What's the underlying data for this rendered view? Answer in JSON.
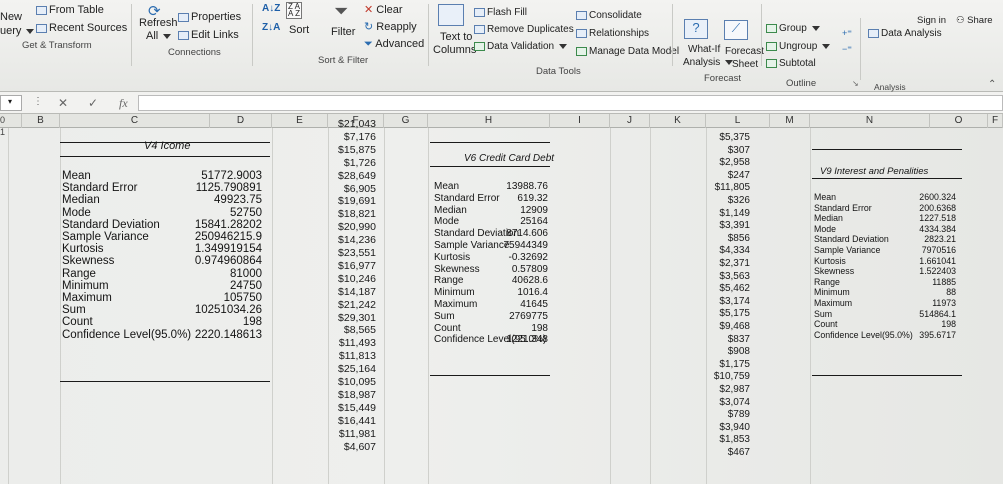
{
  "ribbon": {
    "get_transform": {
      "new_query": "New",
      "new_query_sub": "uery",
      "from_table": "From Table",
      "recent_sources": "Recent Sources",
      "group_label": "Get & Transform"
    },
    "connections": {
      "refresh_all": "Refresh",
      "refresh_all_sub": "All",
      "properties": "Properties",
      "edit_links": "Edit Links",
      "group_label": "Connections"
    },
    "sort_filter": {
      "sort": "Sort",
      "filter": "Filter",
      "clear": "Clear",
      "reapply": "Reapply",
      "advanced": "Advanced",
      "group_label": "Sort & Filter"
    },
    "data_tools": {
      "text_to_columns_1": "Text to",
      "text_to_columns_2": "Columns",
      "flash_fill": "Flash Fill",
      "remove_duplicates": "Remove Duplicates",
      "data_validation": "Data Validation",
      "consolidate": "Consolidate",
      "relationships": "Relationships",
      "manage_data_model": "Manage Data Model",
      "group_label": "Data Tools"
    },
    "forecast": {
      "what_if_1": "What-If",
      "what_if_2": "Analysis",
      "forecast_sheet_1": "Forecast",
      "forecast_sheet_2": "Sheet",
      "group_label": "Forecast"
    },
    "outline": {
      "group": "Group",
      "ungroup": "Ungroup",
      "subtotal": "Subtotal",
      "group_label": "Outline"
    },
    "analysis": {
      "data_analysis": "Data Analysis",
      "group_label": "Analysis"
    },
    "sign_in": "Sign in",
    "share": "Share"
  },
  "formula_bar": {
    "cancel": "✕",
    "enter": "✓",
    "fx": "fx"
  },
  "columns": [
    "B",
    "C",
    "D",
    "E",
    "F",
    "G",
    "H",
    "I",
    "J",
    "K",
    "L",
    "M",
    "N",
    "O",
    "F"
  ],
  "rows": [
    "0",
    "1",
    "",
    "",
    "",
    "",
    "",
    "",
    "",
    "",
    "",
    "",
    "",
    "",
    ""
  ],
  "v4": {
    "title": "V4 Icome",
    "labels": [
      "Mean",
      "Standard Error",
      "Median",
      "Mode",
      "Standard Deviation",
      "Sample Variance",
      "Kurtosis",
      "Skewness",
      "Range",
      "Minimum",
      "Maximum",
      "Sum",
      "Count",
      "Confidence Level(95.0%)"
    ],
    "values": [
      "51772.9003",
      "1125.790891",
      "49923.75",
      "52750",
      "15841.28202",
      "250946215.9",
      "1.349919154",
      "0.974960864",
      "81000",
      "24750",
      "105750",
      "10251034.26",
      "198",
      "2220.148613"
    ]
  },
  "col_f": [
    "$21,043",
    "$7,176",
    "$15,875",
    "$1,726",
    "$28,649",
    "$6,905",
    "$19,691",
    "$18,821",
    "$20,990",
    "$14,236",
    "$23,551",
    "$16,977",
    "$10,246",
    "$14,187",
    "$21,242",
    "$29,301",
    "$8,565",
    "$11,493",
    "$11,813",
    "$25,164",
    "$10,095",
    "$18,987",
    "$15,449",
    "$16,441",
    "$11,981",
    "$4,607"
  ],
  "v6": {
    "title": "V6 Credit Card Debt",
    "labels": [
      "Mean",
      "Standard Error",
      "Median",
      "Mode",
      "Standard Deviation",
      "Sample Variance",
      "Kurtosis",
      "Skewness",
      "Range",
      "Minimum",
      "Maximum",
      "Sum",
      "Count",
      "Confidence Level(95.0%)"
    ],
    "values": [
      "13988.76",
      "619.32",
      "12909",
      "25164",
      "8714.606",
      "75944349",
      "-0.32692",
      "0.57809",
      "40628.6",
      "1016.4",
      "41645",
      "2769775",
      "198",
      "1221.348"
    ]
  },
  "col_l": [
    "$5,375",
    "$307",
    "$2,958",
    "$247",
    "$11,805",
    "$326",
    "$1,149",
    "$3,391",
    "$856",
    "$4,334",
    "$2,371",
    "$3,563",
    "$5,462",
    "$3,174",
    "$5,175",
    "$9,468",
    "$837",
    "$908",
    "$1,175",
    "$10,759",
    "$2,987",
    "$3,074",
    "$789",
    "$3,940",
    "$1,853",
    "$467"
  ],
  "v9": {
    "title": "V9 Interest and Penalities",
    "labels": [
      "Mean",
      "Standard Error",
      "Median",
      "Mode",
      "Standard Deviation",
      "Sample Variance",
      "Kurtosis",
      "Skewness",
      "Range",
      "Minimum",
      "Maximum",
      "Sum",
      "Count",
      "Confidence Level(95.0%)"
    ],
    "values": [
      "2600.324",
      "200.6368",
      "1227.518",
      "4334.384",
      "2823.21",
      "7970516",
      "1.661041",
      "1.522403",
      "11885",
      "88",
      "11973",
      "514864.1",
      "198",
      "395.6717"
    ]
  }
}
